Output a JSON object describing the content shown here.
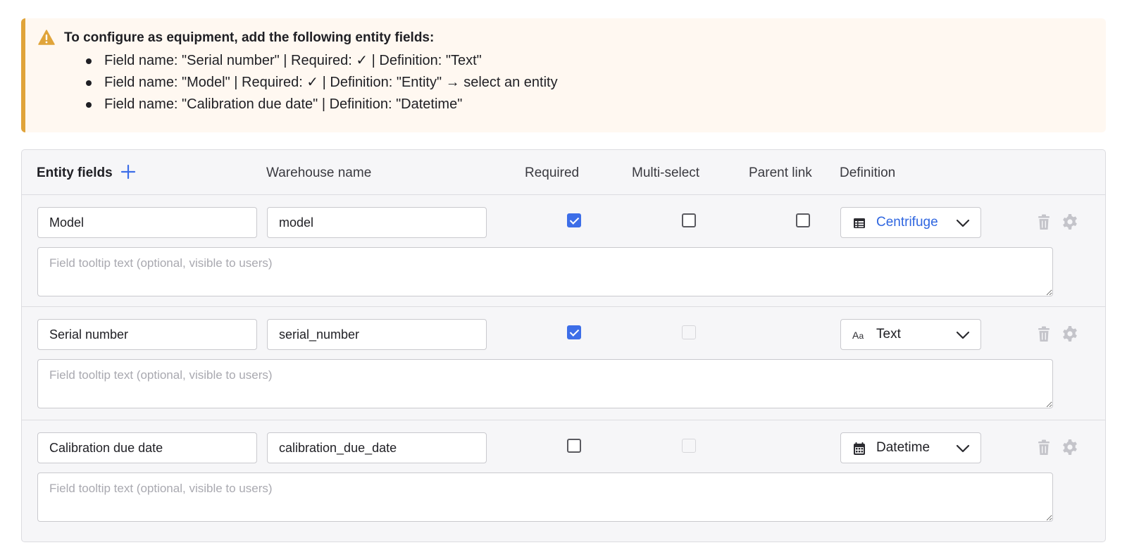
{
  "alert": {
    "title": "To configure as equipment, add the following entity fields:",
    "items": [
      "Field name: \"Serial number\" | Required: ✓ | Definition: \"Text\"",
      "Field name: \"Model\" | Required: ✓ | Definition: \"Entity\" → select an entity",
      "Field name: \"Calibration due date\" | Definition: \"Datetime\""
    ]
  },
  "table": {
    "headers": {
      "entity_fields": "Entity fields",
      "warehouse_name": "Warehouse name",
      "required": "Required",
      "multi_select": "Multi-select",
      "parent_link": "Parent link",
      "definition": "Definition"
    },
    "rows": [
      {
        "name": "Model",
        "warehouse": "model",
        "required": true,
        "multi_select": false,
        "multi_select_enabled": true,
        "parent_link": false,
        "parent_link_visible": true,
        "definition": "Centrifuge",
        "definition_icon": "table-icon",
        "tooltip_placeholder": "Field tooltip text (optional, visible to users)"
      },
      {
        "name": "Serial number",
        "warehouse": "serial_number",
        "required": true,
        "multi_select": false,
        "multi_select_enabled": false,
        "parent_link_visible": false,
        "definition": "Text",
        "definition_icon": "text-type-icon",
        "tooltip_placeholder": "Field tooltip text (optional, visible to users)"
      },
      {
        "name": "Calibration due date",
        "warehouse": "calibration_due_date",
        "required": false,
        "multi_select": false,
        "multi_select_enabled": false,
        "parent_link_visible": false,
        "definition": "Datetime",
        "definition_icon": "calendar-icon",
        "tooltip_placeholder": "Field tooltip text (optional, visible to users)"
      }
    ]
  },
  "colors": {
    "accent": "#3d6ee8",
    "link": "#2f66e0",
    "warning": "#e0a43a",
    "alert_bg": "#fff8f1"
  }
}
